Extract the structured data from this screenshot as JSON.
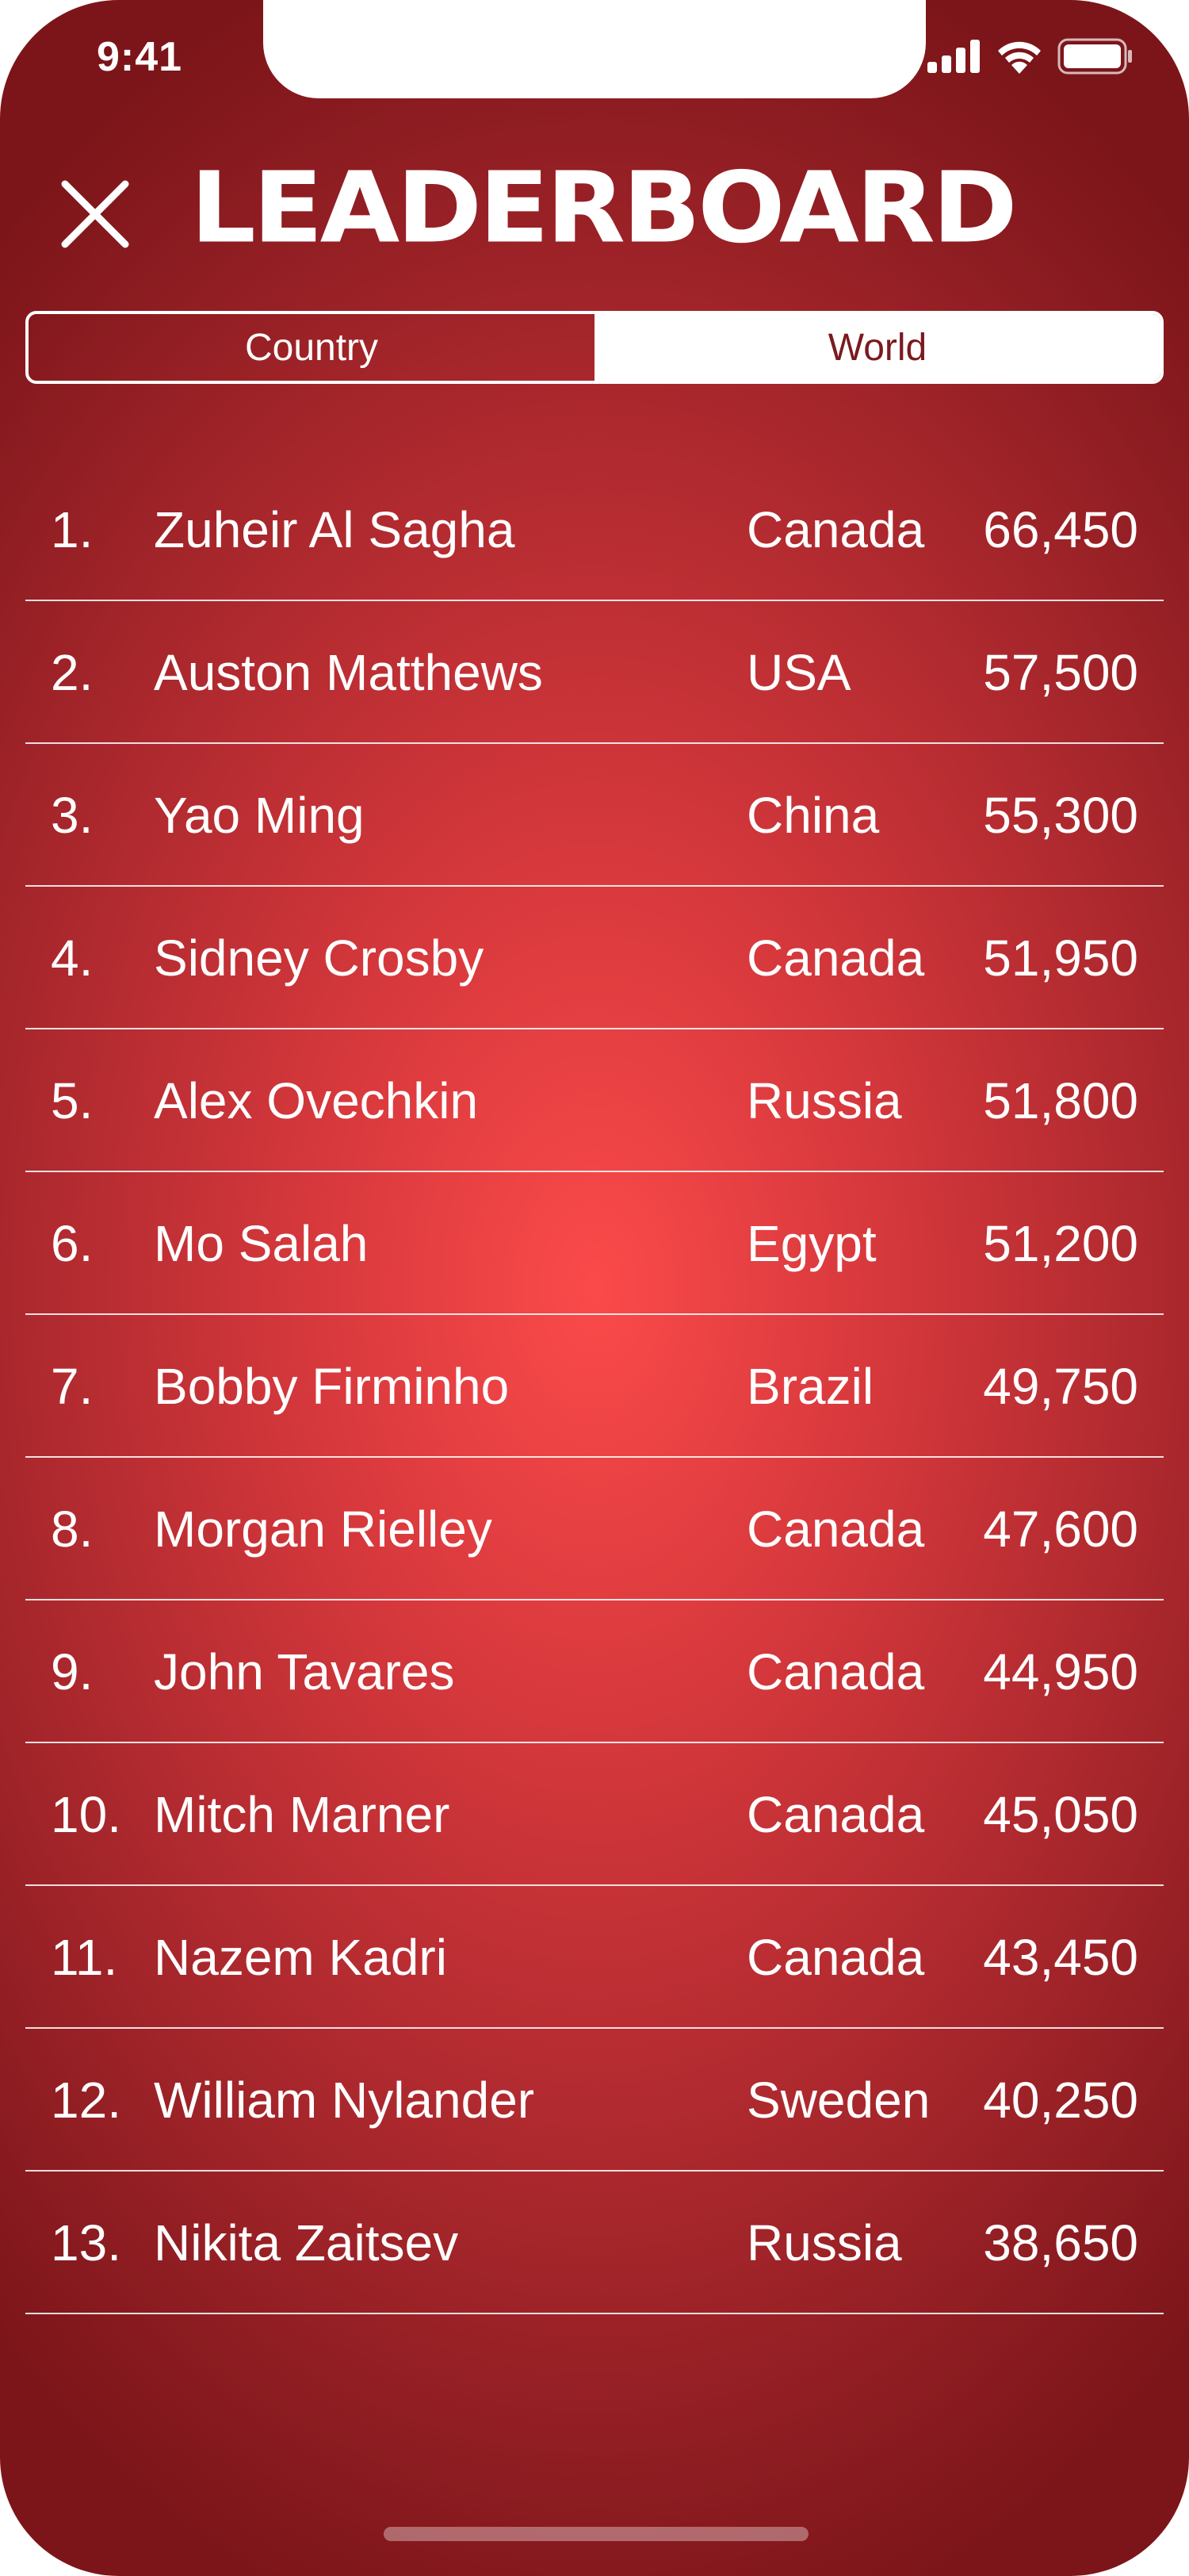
{
  "status_bar": {
    "time": "9:41",
    "icons": [
      "cellular-signal-icon",
      "wifi-icon",
      "battery-icon"
    ]
  },
  "header": {
    "close_icon": "close-icon",
    "title": "LEADERBOARD"
  },
  "tabs": [
    {
      "label": "Country",
      "selected": false
    },
    {
      "label": "World",
      "selected": true
    }
  ],
  "leaderboard": [
    {
      "rank": "1.",
      "name": "Zuheir Al Sagha",
      "country": "Canada",
      "score": "66,450"
    },
    {
      "rank": "2.",
      "name": "Auston Matthews",
      "country": "USA",
      "score": "57,500"
    },
    {
      "rank": "3.",
      "name": "Yao Ming",
      "country": "China",
      "score": "55,300"
    },
    {
      "rank": "4.",
      "name": "Sidney Crosby",
      "country": "Canada",
      "score": "51,950"
    },
    {
      "rank": "5.",
      "name": "Alex Ovechkin",
      "country": "Russia",
      "score": "51,800"
    },
    {
      "rank": "6.",
      "name": "Mo Salah",
      "country": "Egypt",
      "score": "51,200"
    },
    {
      "rank": "7.",
      "name": "Bobby Firminho",
      "country": "Brazil",
      "score": "49,750"
    },
    {
      "rank": "8.",
      "name": "Morgan Rielley",
      "country": "Canada",
      "score": "47,600"
    },
    {
      "rank": "9.",
      "name": "John Tavares",
      "country": "Canada",
      "score": "44,950"
    },
    {
      "rank": "10.",
      "name": "Mitch Marner",
      "country": "Canada",
      "score": "45,050"
    },
    {
      "rank": "11.",
      "name": "Nazem Kadri",
      "country": "Canada",
      "score": "43,450"
    },
    {
      "rank": "12.",
      "name": "William Nylander",
      "country": "Sweden",
      "score": "40,250"
    },
    {
      "rank": "13.",
      "name": "Nikita Zaitsev",
      "country": "Russia",
      "score": "38,650"
    }
  ],
  "colors": {
    "background_center": "#fb4a4a",
    "background_edge": "#7c1519",
    "text": "#ffffff",
    "active_tab_text": "#7a1a1e"
  }
}
